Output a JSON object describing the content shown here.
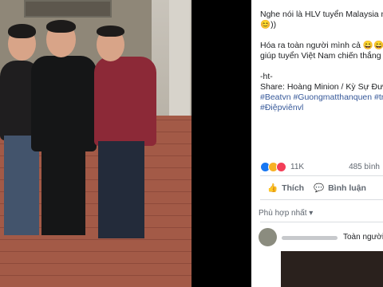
{
  "post": {
    "lines": [
      "Nghe nói là HLV tuyển Malaysia m",
      "😊))",
      "",
      "Hóa ra toàn người mình cả 😄😄",
      "giúp tuyển Việt Nam chiến thắng 🇻",
      "",
      "-ht-",
      "Share: Hoàng Minion / Kỳ Sự Đườ"
    ],
    "hashtags": [
      "#Beatvn #Guongmatthanquen #trả",
      "#Điệpviênvl"
    ]
  },
  "reactions": {
    "count": "11K",
    "shares": "485 bình",
    "colors": [
      "#1877f2",
      "#f7b125",
      "#f33e58"
    ]
  },
  "actions": {
    "like": "Thích",
    "comment": "Bình luận"
  },
  "comments": {
    "sort": "Phù hợp nhất",
    "author": "Toàn người"
  }
}
